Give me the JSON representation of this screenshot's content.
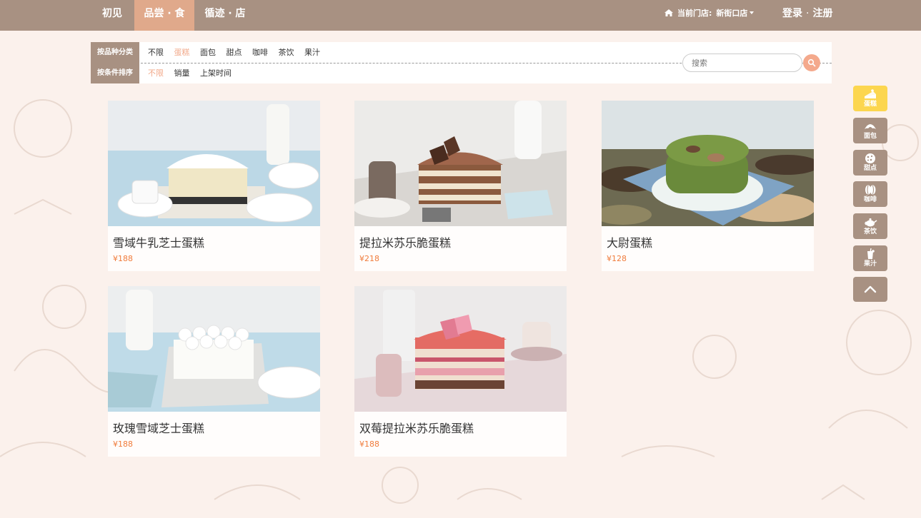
{
  "nav": {
    "items": [
      "初见",
      "品尝 · 食",
      "循迹 · 店"
    ],
    "active_index": 1,
    "store_label": "当前门店:",
    "store_name": "新街口店",
    "login": "登录",
    "register": "注册",
    "auth_sep": "·"
  },
  "filters": {
    "category_label": "按品种分类",
    "categories": [
      "不限",
      "蛋糕",
      "面包",
      "甜点",
      "咖啡",
      "茶饮",
      "果汁"
    ],
    "category_selected": "蛋糕",
    "sort_label": "按条件排序",
    "sorts": [
      "不限",
      "销量",
      "上架时间"
    ],
    "sort_selected": "不限",
    "search_placeholder": "搜索"
  },
  "products": [
    {
      "name": "雪域牛乳芝士蛋糕",
      "price": "¥188"
    },
    {
      "name": "提拉米苏乐脆蛋糕",
      "price": "¥218"
    },
    {
      "name": "大尉蛋糕",
      "price": "¥128"
    },
    {
      "name": "玫瑰雪域芝士蛋糕",
      "price": "¥188"
    },
    {
      "name": "双莓提拉米苏乐脆蛋糕",
      "price": "¥188"
    }
  ],
  "side_nav": {
    "items": [
      {
        "label": "蛋糕",
        "icon": "cake-icon"
      },
      {
        "label": "面包",
        "icon": "croissant-icon"
      },
      {
        "label": "甜点",
        "icon": "cookie-icon"
      },
      {
        "label": "咖啡",
        "icon": "coffee-bean-icon"
      },
      {
        "label": "茶饮",
        "icon": "teapot-icon"
      },
      {
        "label": "果汁",
        "icon": "juice-icon"
      }
    ],
    "active_index": 0
  },
  "colors": {
    "nav_bg": "#a89182",
    "nav_active": "#e0a98b",
    "accent": "#f4a98c",
    "price": "#f07c3c",
    "side_active": "#fcd64f",
    "page_bg": "#fbf1ec"
  }
}
